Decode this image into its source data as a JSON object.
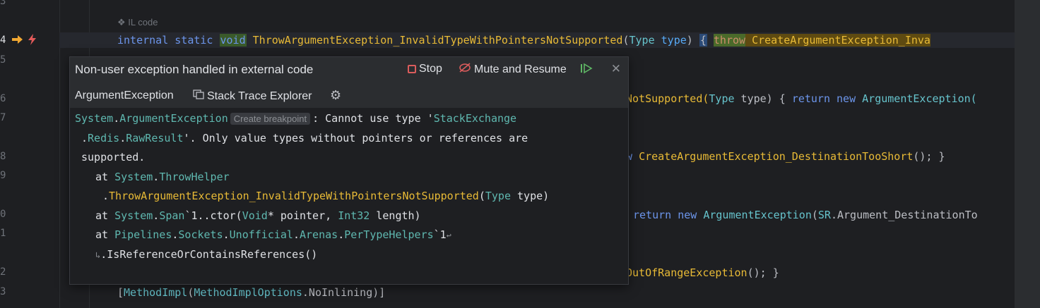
{
  "editor": {
    "line_numbers": [
      "3",
      "4",
      "5",
      "6",
      "7",
      "8",
      "9",
      "0",
      "1",
      "2",
      "3"
    ],
    "il_code_label": "IL code",
    "line4": {
      "kw_internal": "internal",
      "kw_static": "static",
      "kw_void": "void",
      "method": "ThrowArgumentException_InvalidTypeWithPointersNotSupported",
      "open": "(",
      "param_type": "Type",
      "param_name": "type",
      "close": ") ",
      "brace": "{",
      "kw_throw": "throw",
      "call": " CreateArgumentException_Inva"
    },
    "line6_tail": {
      "a": "NotSupported(",
      "b": "Type",
      "c": " type) { ",
      "d": "return",
      "e": " ",
      "f": "new",
      "g": " ",
      "h": "ArgumentException("
    },
    "line8_tail": {
      "a": "w ",
      "b": "CreateArgumentException_DestinationTooShort",
      "c": "(); }"
    },
    "line10_tail": {
      "a": "return",
      "b": " ",
      "c": "new",
      "d": " ",
      "e": "ArgumentException",
      "f": "(",
      "g": "SR",
      "h": ".Argument_DestinationTo"
    },
    "line12_tail": {
      "a": "OutOfRangeException",
      "b": "(); }"
    },
    "line13": {
      "a": "[",
      "b": "MethodImpl",
      "c": "(",
      "d": "MethodImplOptions",
      "e": ".NoInlining)]"
    }
  },
  "popup": {
    "title": "Non-user exception handled in external code",
    "stop_label": "Stop",
    "mute_label": "Mute and Resume",
    "exception_type": "ArgumentException",
    "stack_trace_label": "Stack Trace Explorer",
    "create_breakpoint": "Create breakpoint",
    "message": {
      "l1_a": "System",
      "l1_b": ".",
      "l1_c": "ArgumentException",
      "l1_d": ": Cannot use type '",
      "l1_e": "StackExchange",
      "l2_a": ".",
      "l2_b": "Redis",
      "l2_c": ".",
      "l2_d": "RawResult",
      "l2_e": "'. Only value types without pointers or references are",
      "l3": "supported.",
      "l4_a": "at ",
      "l4_b": "System",
      "l4_c": ".",
      "l4_d": "ThrowHelper",
      "l5_a": ".",
      "l5_b": "ThrowArgumentException_InvalidTypeWithPointersNotSupported",
      "l5_c": "(",
      "l5_d": "Type",
      "l5_e": " type)",
      "l6_a": "at ",
      "l6_b": "System",
      "l6_c": ".",
      "l6_d": "Span",
      "l6_e": "`1..ctor(",
      "l6_f": "Void",
      "l6_g": "* pointer, ",
      "l6_h": "Int32",
      "l6_i": " length)",
      "l7_a": "at ",
      "l7_b": "Pipelines",
      "l7_c": ".",
      "l7_d": "Sockets",
      "l7_e": ".",
      "l7_f": "Unofficial",
      "l7_g": ".",
      "l7_h": "Arenas",
      "l7_i": ".",
      "l7_j": "PerTypeHelpers",
      "l7_k": "`1",
      "l8": ".IsReferenceOrContainsReferences()"
    }
  },
  "icons": {
    "execution_arrow": "execution-arrow-icon",
    "exception_bolt": "exception-bolt-icon"
  },
  "colors": {
    "background": "#1e1f22",
    "popup_bg": "#2b2d30",
    "keyword": "#cf8e6d",
    "keyword_blue": "#6c95eb",
    "type_cyan": "#66c3cc",
    "method_yellow": "#e8ba36",
    "stop_red": "#db5c5c",
    "resume_green": "#5fb865"
  }
}
